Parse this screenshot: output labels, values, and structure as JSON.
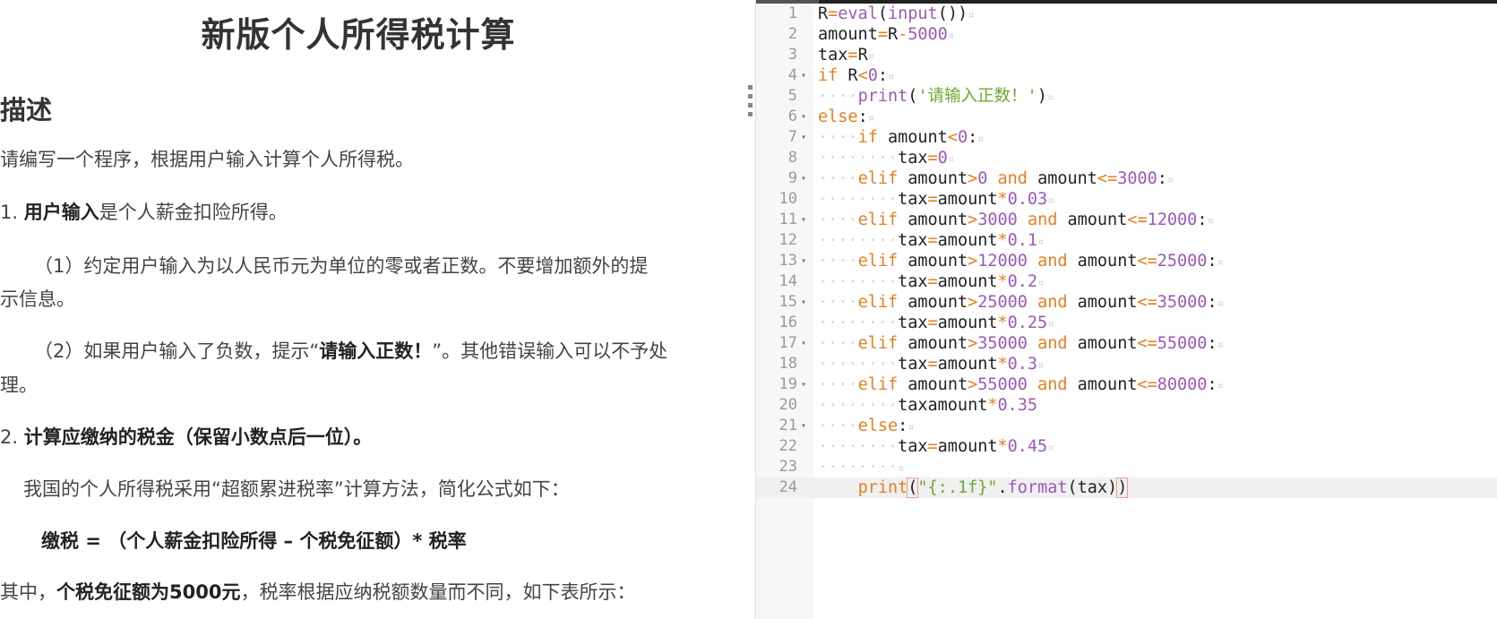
{
  "problem": {
    "title": "新版个人所得税计算",
    "section_heading": "描述",
    "description": "请编写一个程序，根据用户输入计算个人所得税。",
    "item1_prefix": "1. ",
    "item1_bold": "用户输入",
    "item1_rest": "是个人薪金扣险所得。",
    "rule1_line1": "（1）约定用户输入为以人民币元为单位的零或者正数。不要增加额外的提",
    "rule1_line2": "示信息。",
    "rule2_prefix": "（2）如果用户输入了负数，提示“",
    "rule2_bold": "请输入正数！",
    "rule2_suffix": "”。其他错误输入可以不予处",
    "rule2_line2": "理。",
    "item2_prefix": "2. ",
    "item2_bold": "计算应缴纳的税金（保留小数点后一位）。",
    "intro": "我国的个人所得税采用“超额累进税率”计算方法，简化公式如下：",
    "formula": "缴税 = （个人薪金扣险所得 – 个税免征额）* 税率",
    "note_prefix": "其中，",
    "note_bold": "个税免征额为5000元",
    "note_suffix": "，税率根据应纳税额数量而不同，如下表所示："
  },
  "editor": {
    "line_numbers": [
      "1",
      "2",
      "3",
      "4",
      "5",
      "6",
      "7",
      "8",
      "9",
      "10",
      "11",
      "12",
      "13",
      "14",
      "15",
      "16",
      "17",
      "18",
      "19",
      "20",
      "21",
      "22",
      "23",
      "24"
    ],
    "fold_marker": "▾",
    "active_line": 24,
    "colors": {
      "keyword": "#e67e22",
      "number": "#9b59b6",
      "string": "#6da831",
      "gutter": "#f7f7f7",
      "active_line": "#f0f0f0"
    }
  }
}
